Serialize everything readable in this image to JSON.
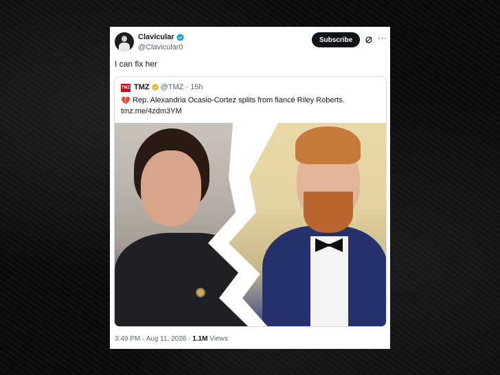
{
  "colors": {
    "accent_verified": "#1d9bf0",
    "tmz_red": "#d0021b",
    "gold_badge": "#e2b719",
    "text_primary": "#0f1419",
    "text_secondary": "#536471"
  },
  "tweet": {
    "author_name": "Clavicular",
    "author_handle": "@Clavicular0",
    "subscribe_label": "Subscribe",
    "more_icon_text": "···",
    "text": "I can fix her",
    "timestamp": "3:49 PM · Aug 11, 2026 · ",
    "views_count": "1.1M",
    "views_label": " Views"
  },
  "quote": {
    "logo_text": "TMZ",
    "author_name": "TMZ",
    "author_handle": "@TMZ · 15h",
    "heart_icon": "💔",
    "text": "Rep. Alexandria Ocasio-Cortez splits from fiancé Riley Roberts.",
    "link": "tmz.me/4zdm3YM"
  },
  "icons": {
    "verified": "verified-icon",
    "grok": "grok-icon",
    "more": "more-icon",
    "broken_heart": "broken-heart-icon"
  }
}
